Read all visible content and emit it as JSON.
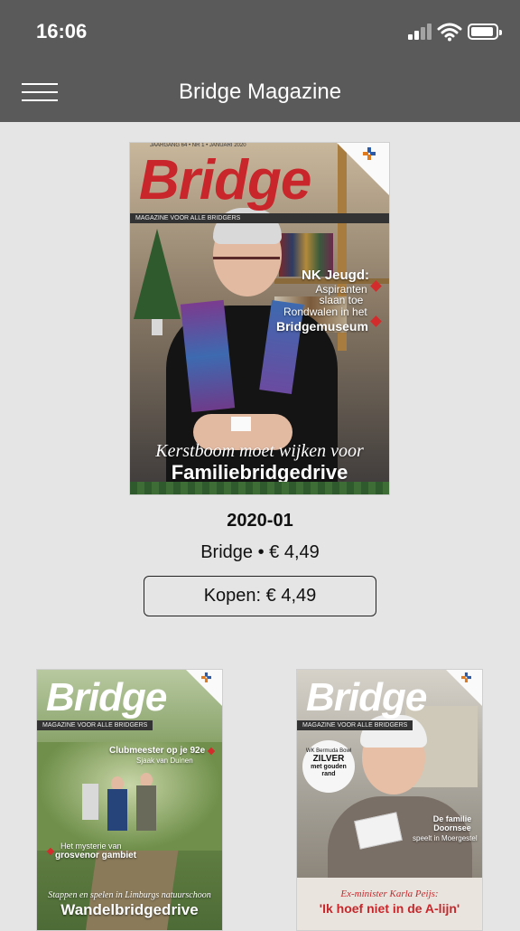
{
  "status": {
    "time": "16:06",
    "icons": [
      "signal-icon",
      "wifi-icon",
      "battery-icon"
    ]
  },
  "nav": {
    "title": "Bridge Magazine",
    "menu_icon": "hamburger-menu-icon"
  },
  "featured": {
    "cover": {
      "brand": "Bridge",
      "tagline": "MAGAZINE VOOR ALLE BRIDGERS",
      "issue_line": "JAARGANG 64 • NR 1 • JANUARI 2020",
      "side_1_title": "NK Jeugd:",
      "side_1_sub": "Aspiranten slaan toe",
      "side_2_sub": "Rondwalen in het",
      "side_2_title": "Bridgemuseum",
      "headline_script": "Kerstboom moet wijken voor",
      "headline_bold": "Familiebridgedrive"
    },
    "title": "2020-01",
    "subtitle": "Bridge • € 4,49",
    "buy_label": "Kopen: € 4,49"
  },
  "grid": [
    {
      "brand": "Bridge",
      "tagline": "MAGAZINE VOOR ALLE BRIDGERS",
      "side_1_title": "Clubmeester op je 92e",
      "side_1_sub": "Sjaak van Duinen",
      "side_2_sub": "Het mysterie van",
      "side_2_title": "grosvenor gambiet",
      "headline_script": "Stappen en spelen in Limburgs natuurschoon",
      "headline_bold": "Wandelbridgedrive"
    },
    {
      "brand": "Bridge",
      "tagline": "MAGAZINE VOOR ALLE BRIDGERS",
      "badge_line_1": "WK Bermuda Bowl",
      "badge_line_2": "ZILVER",
      "badge_line_3": "met gouden rand",
      "side_1_title": "De familie Doornsee",
      "side_1_sub": "speelt in Moergestel",
      "headline_script": "Ex-minister Karla Peijs:",
      "headline_bold": "'Ik hoef niet in de A-lijn'"
    }
  ],
  "colors": {
    "bar": "#5a5a5a",
    "background": "#e5e5e5",
    "brand_red": "#c8262b",
    "brand_white": "#ffffff"
  }
}
